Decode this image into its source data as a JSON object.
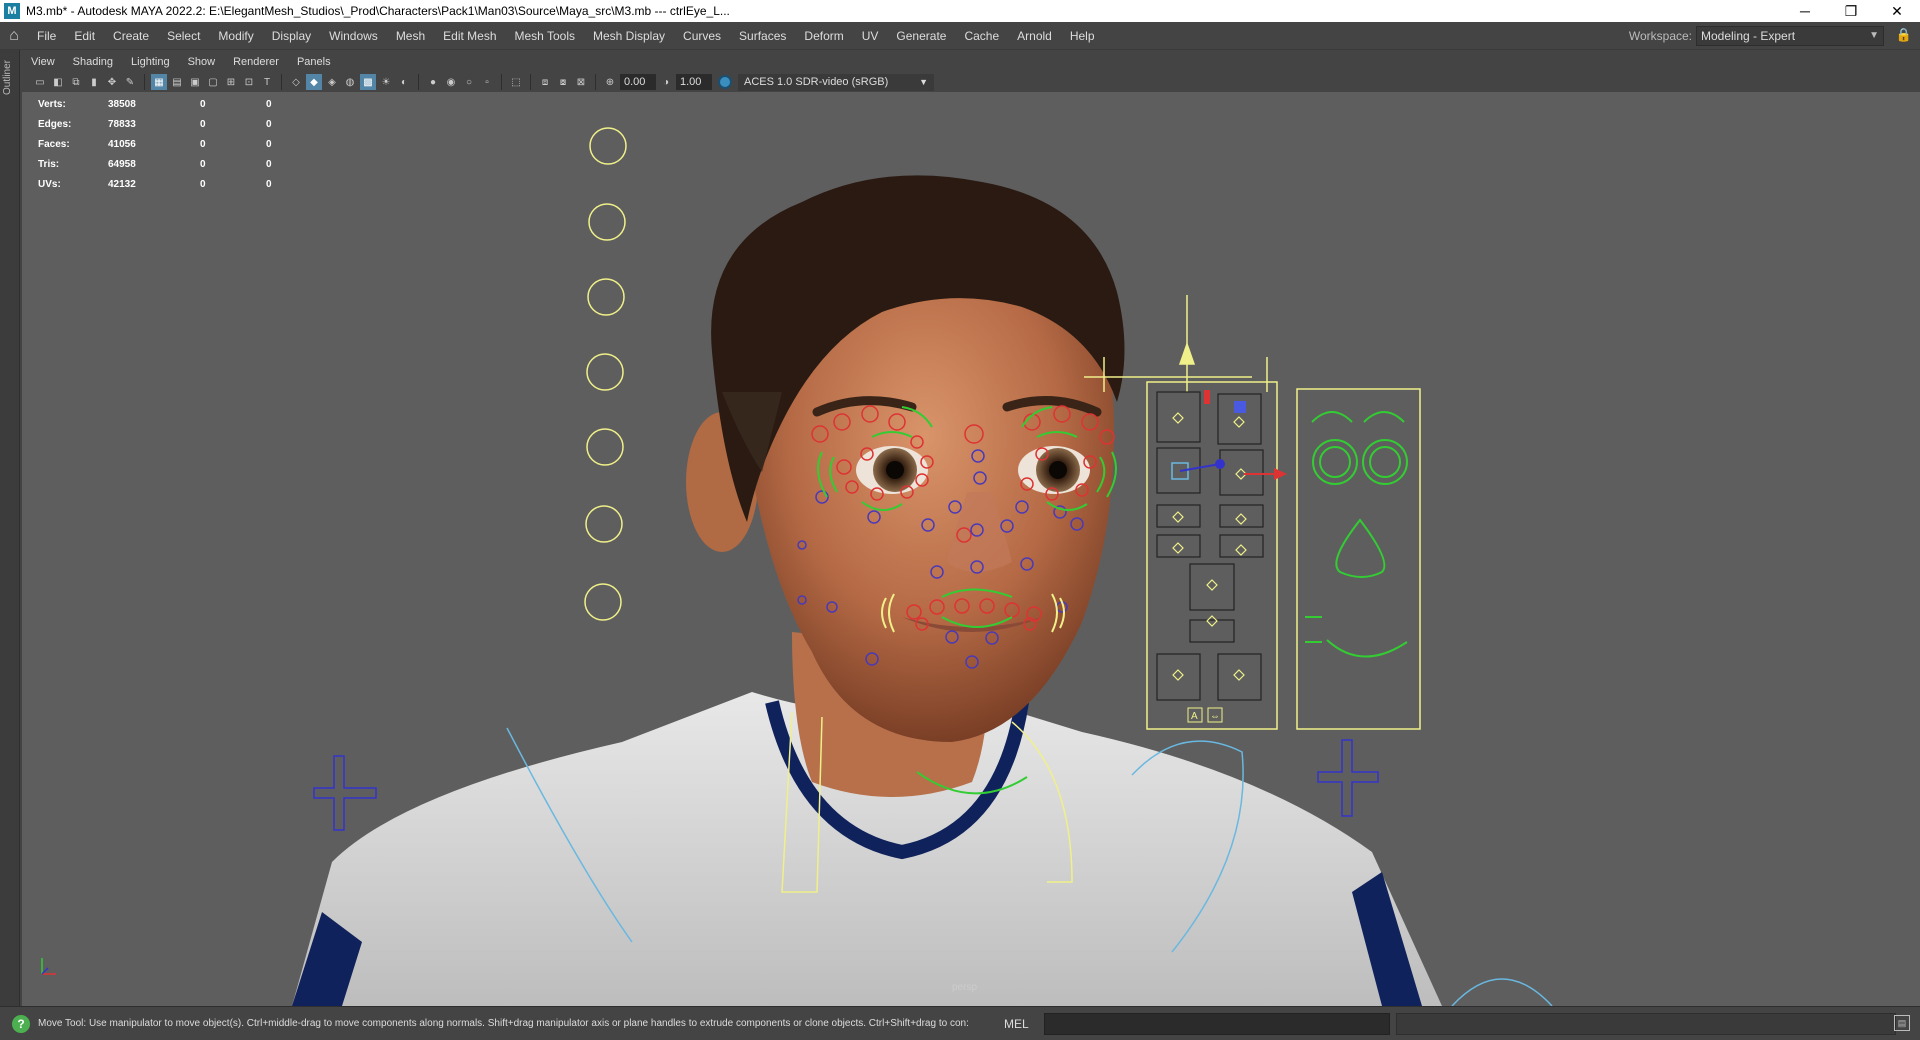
{
  "window": {
    "title": "M3.mb* - Autodesk MAYA 2022.2: E:\\ElegantMesh_Studios\\_Prod\\Characters\\Pack1\\Man03\\Source\\Maya_src\\M3.mb   ---   ctrlEye_L...",
    "app_icon": "M",
    "minimize": "─",
    "restore": "❐",
    "close": "✕"
  },
  "menubar": {
    "home_icon": "⌂",
    "items": [
      "File",
      "Edit",
      "Create",
      "Select",
      "Modify",
      "Display",
      "Windows",
      "Mesh",
      "Edit Mesh",
      "Mesh Tools",
      "Mesh Display",
      "Curves",
      "Surfaces",
      "Deform",
      "UV",
      "Generate",
      "Cache",
      "Arnold",
      "Help"
    ],
    "workspace_label": "Workspace:",
    "workspace_value": "Modeling - Expert",
    "lock_icon": "🔒"
  },
  "left_strip": {
    "label": "Outliner"
  },
  "panel_menu": [
    "View",
    "Shading",
    "Lighting",
    "Show",
    "Renderer",
    "Panels"
  ],
  "panel_toolbar": {
    "exposure": "0.00",
    "gamma": "1.00",
    "color_space": "ACES 1.0 SDR-video (sRGB)"
  },
  "hud": {
    "rows": [
      {
        "label": "Verts:",
        "v1": "38508",
        "v2": "0",
        "v3": "0"
      },
      {
        "label": "Edges:",
        "v1": "78833",
        "v2": "0",
        "v3": "0"
      },
      {
        "label": "Faces:",
        "v1": "41056",
        "v2": "0",
        "v3": "0"
      },
      {
        "label": "Tris:",
        "v1": "64958",
        "v2": "0",
        "v3": "0"
      },
      {
        "label": "UVs:",
        "v1": "42132",
        "v2": "0",
        "v3": "0"
      }
    ]
  },
  "viewport": {
    "camera": "persp",
    "background": "#5e5e5e",
    "facial_panel_labels": [
      "A",
      "⇔"
    ]
  },
  "helpline": {
    "icon": "?",
    "message": "Move Tool: Use manipulator to move object(s). Ctrl+middle-drag to move components along normals. Shift+drag manipulator axis or plane handles to extrude components or clone objects. Ctrl+Shift+drag to con:",
    "command_type": "MEL"
  },
  "colors": {
    "selection_yellow": "#f0f08a",
    "ctrl_red": "#d33",
    "ctrl_green": "#3c3",
    "ctrl_blue": "#33c",
    "accent": "#5285a6"
  }
}
